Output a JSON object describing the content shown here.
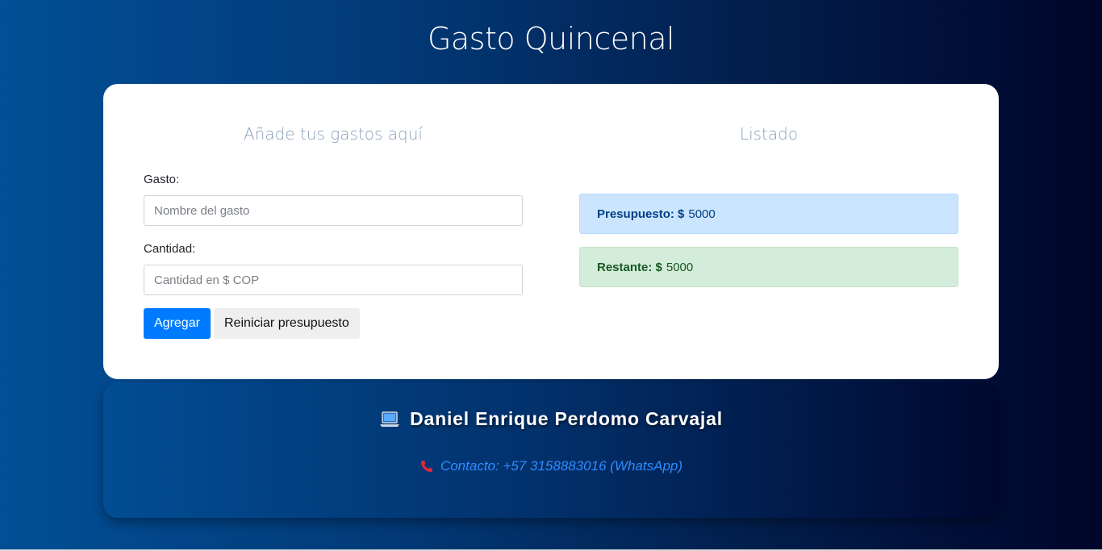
{
  "header": {
    "title": "Gasto Quincenal"
  },
  "form": {
    "heading": "Añade tus gastos aquí",
    "expense_label": "Gasto:",
    "expense_placeholder": "Nombre del gasto",
    "expense_value": "",
    "amount_label": "Cantidad:",
    "amount_placeholder": "Cantidad en $ COP",
    "amount_value": "",
    "add_button": "Agregar",
    "reset_button": "Reiniciar presupuesto"
  },
  "listing": {
    "heading": "Listado",
    "budget_label": "Presupuesto: $",
    "budget_value": "5000",
    "remaining_label": "Restante: $",
    "remaining_value": "5000"
  },
  "footer": {
    "author_icon": "laptop-icon",
    "author": "Daniel Enrique Perdomo Carvajal",
    "contact_icon": "phone-icon",
    "contact": "Contacto: +57 3158883016 (WhatsApp)"
  },
  "colors": {
    "primary": "#007bff",
    "budget_bg": "#cce5ff",
    "remaining_bg": "#d4edda",
    "contact_text": "#2f8cff",
    "phone_icon": "#e3263b"
  }
}
